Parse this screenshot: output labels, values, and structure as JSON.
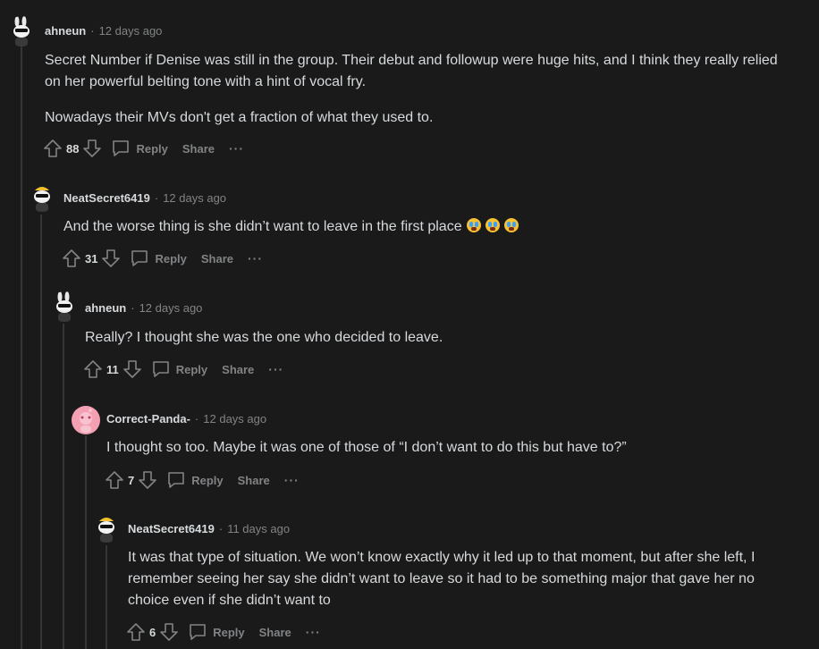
{
  "comments": [
    {
      "user": "ahneun",
      "time": "12 days ago",
      "paragraphs": [
        "Secret Number if Denise was still in the group. Their debut and followup were huge hits, and I think they really relied on her powerful belting tone with a hint of vocal fry.",
        "Nowadays their MVs don't get a fraction of what they used to."
      ],
      "votes": "88",
      "reply": "Reply",
      "share": "Share",
      "more": "···"
    },
    {
      "user": "NeatSecret6419",
      "time": "12 days ago",
      "paragraphs": [
        "And the worse thing is she didn’t want to leave in the first place"
      ],
      "votes": "31",
      "reply": "Reply",
      "share": "Share",
      "more": "···"
    },
    {
      "user": "ahneun",
      "time": "12 days ago",
      "paragraphs": [
        "Really? I thought she was the one who decided to leave."
      ],
      "votes": "11",
      "reply": "Reply",
      "share": "Share",
      "more": "···"
    },
    {
      "user": "Correct-Panda-",
      "time": "12 days ago",
      "paragraphs": [
        "I thought so too. Maybe it was one of those of “I don’t want to do this but have to?”"
      ],
      "votes": "7",
      "reply": "Reply",
      "share": "Share",
      "more": "···"
    },
    {
      "user": "NeatSecret6419",
      "time": "11 days ago",
      "paragraphs": [
        "It was that type of situation. We won’t know exactly why it led up to that moment, but after she left, I remember seeing her say she didn’t want to leave so it had to be something major that gave her no choice even if she didn’t want to"
      ],
      "votes": "6",
      "reply": "Reply",
      "share": "Share",
      "more": "···"
    }
  ],
  "separator": "·",
  "icons": [
    "upvote-icon",
    "downvote-icon",
    "comment-bubble-icon",
    "crying-face-emoji",
    "snoo-avatar-icon"
  ]
}
